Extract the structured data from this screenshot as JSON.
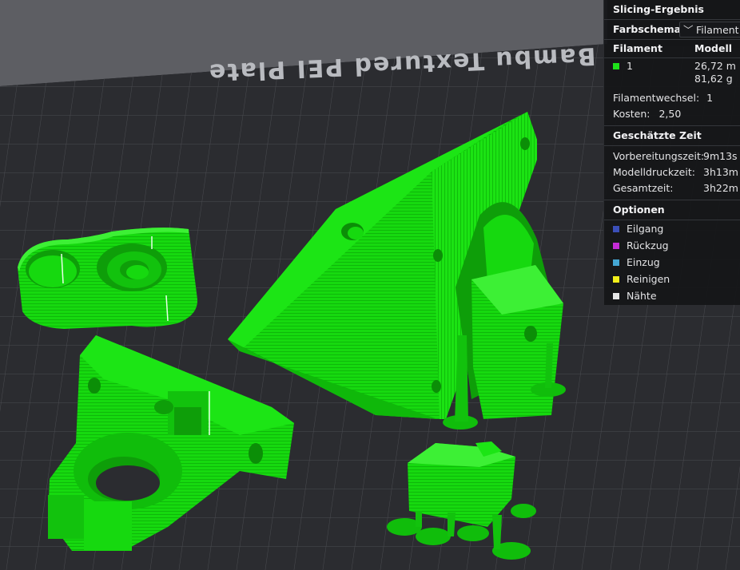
{
  "scene": {
    "plate_label": "Bambu Textured PEI Plate",
    "colors": {
      "background": "#1f2023",
      "plate": "#2b2c30",
      "grid": "#4a4b50",
      "model_green": "#16d90f",
      "model_green_dark": "#0ea508",
      "model_green_light": "#3df035"
    }
  },
  "panel": {
    "title": "Slicing-Ergebnis",
    "color_scheme_label": "Farbschema",
    "color_scheme_value": "Filament",
    "table_header": {
      "col1": "Filament",
      "col2": "Modell"
    },
    "filament": {
      "id": "1",
      "color": "#1ee21a",
      "length": "26,72 m",
      "weight": "81,62 g"
    },
    "filament_changes": {
      "label": "Filamentwechsel:",
      "value": "1"
    },
    "cost": {
      "label": "Kosten:",
      "value": "2,50"
    },
    "time_section": "Geschätzte Zeit",
    "prep_time": {
      "label": "Vorbereitungszeit:",
      "value": "9m13s"
    },
    "print_time": {
      "label": "Modelldruckzeit:",
      "value": "3h13m"
    },
    "total_time": {
      "label": "Gesamtzeit:",
      "value": "3h22m"
    },
    "options_section": "Optionen",
    "options": [
      {
        "label": "Eilgang",
        "color": "#3b4fb8"
      },
      {
        "label": "Rückzug",
        "color": "#c42bd6"
      },
      {
        "label": "Einzug",
        "color": "#44a6d3"
      },
      {
        "label": "Reinigen",
        "color": "#f2ee1a"
      },
      {
        "label": "Nähte",
        "color": "#e6e6e6"
      }
    ]
  }
}
